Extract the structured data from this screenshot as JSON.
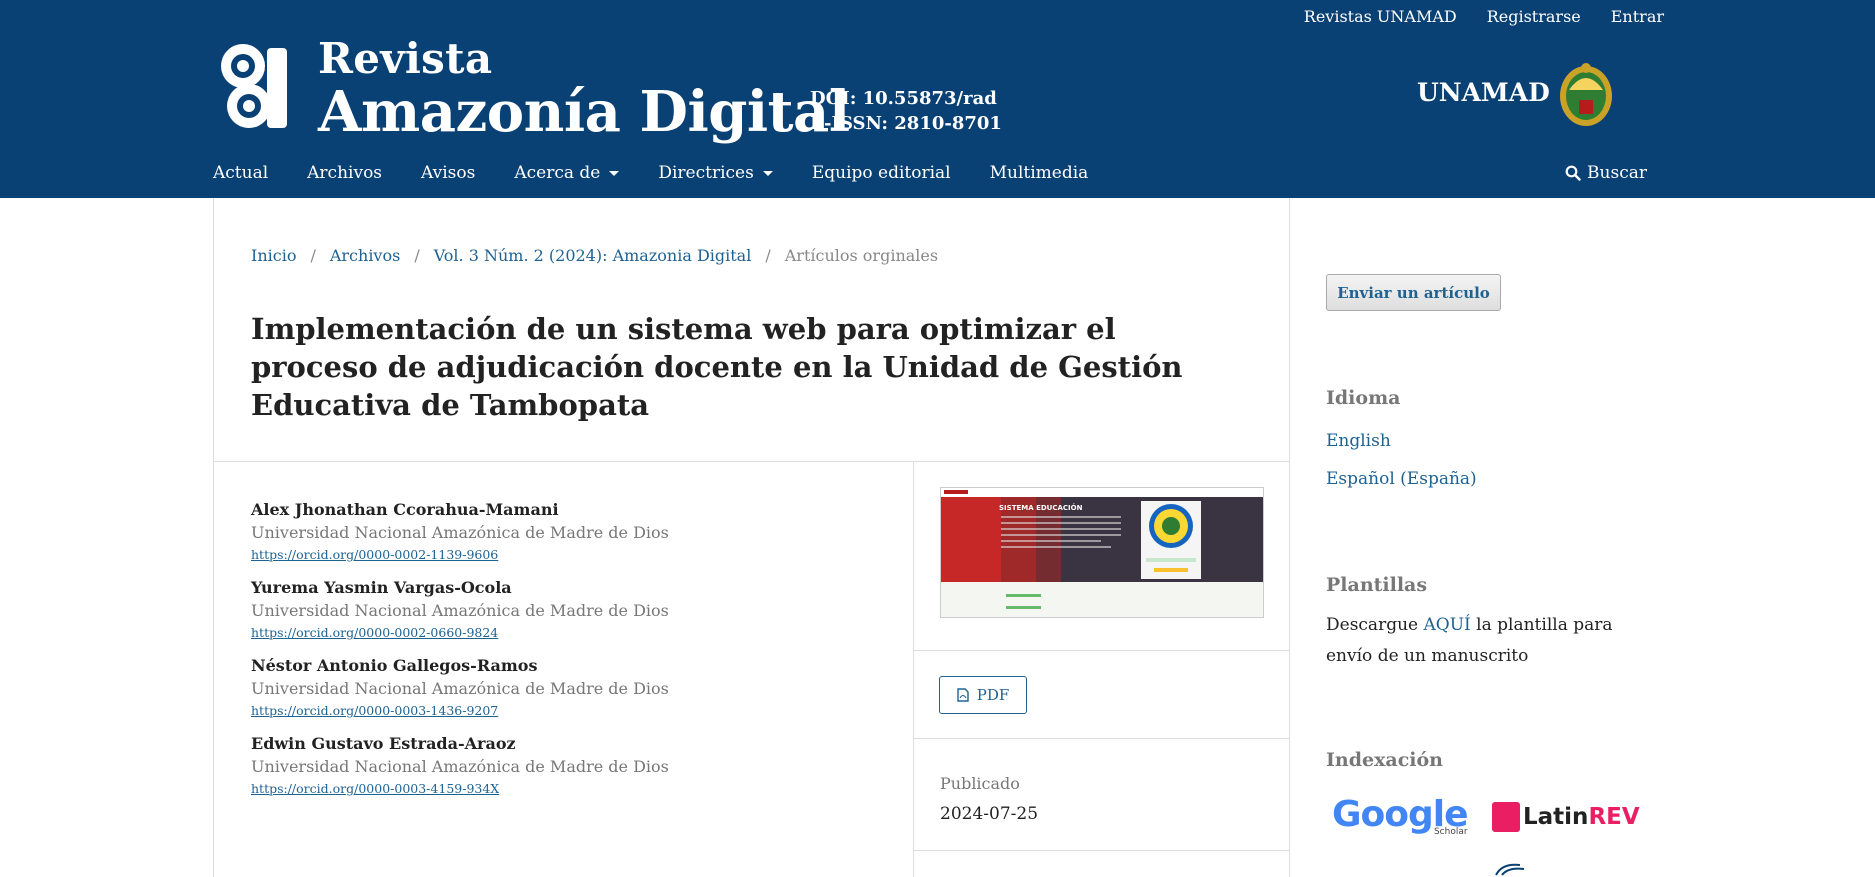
{
  "user_nav": [
    "Revistas UNAMAD",
    "Registrarse",
    "Entrar"
  ],
  "site": {
    "title_line1": "Revista",
    "title_line2": "Amazonía Digital",
    "doi": "DOI: 10.55873/rad",
    "issn": "E-ISSN: 2810-8701",
    "institution": "UNAMAD"
  },
  "main_nav": {
    "items": [
      "Actual",
      "Archivos",
      "Avisos",
      "Acerca de",
      "Directrices",
      "Equipo editorial",
      "Multimedia"
    ],
    "search_label": "Buscar"
  },
  "breadcrumb": {
    "items": [
      "Inicio",
      "Archivos",
      "Vol. 3 Núm. 2 (2024): Amazonia Digital"
    ],
    "current": "Artículos orginales",
    "separator": "/"
  },
  "article": {
    "title": "Implementación de un sistema web para optimizar el proceso de adjudicación docente en la Unidad de Gestión Educativa de Tambopata",
    "authors": [
      {
        "name": "Alex Jhonathan Ccorahua-Mamani",
        "affiliation": "Universidad Nacional Amazónica de Madre de Dios",
        "orcid": "https://orcid.org/0000-0002-1139-9606"
      },
      {
        "name": "Yurema Yasmin Vargas-Ocola",
        "affiliation": "Universidad Nacional Amazónica de Madre de Dios",
        "orcid": "https://orcid.org/0000-0002-0660-9824"
      },
      {
        "name": "Néstor Antonio Gallegos-Ramos",
        "affiliation": "Universidad Nacional Amazónica de Madre de Dios",
        "orcid": "https://orcid.org/0000-0003-1436-9207"
      },
      {
        "name": "Edwin Gustavo Estrada-Araoz",
        "affiliation": "Universidad Nacional Amazónica de Madre de Dios",
        "orcid": "https://orcid.org/0000-0003-4159-934X"
      }
    ],
    "pdf_label": "PDF",
    "published_label": "Publicado",
    "published_date": "2024-07-25",
    "thumbnail_heading": "SISTEMA EDUCACIÓN"
  },
  "sidebar": {
    "submit_label": "Enviar un artículo",
    "language_heading": "Idioma",
    "languages": [
      "English",
      "Español (España)"
    ],
    "templates_heading": "Plantillas",
    "templates_text_before": "Descargue ",
    "templates_link": "AQUÍ",
    "templates_text_after": " la plantilla para envío de un manuscrito",
    "indexing_heading": "Indexación",
    "google_scholar": "Google",
    "google_scholar_sub": "Scholar",
    "latinrev_prefix": "Latin",
    "latinrev_suffix": "REV"
  },
  "colors": {
    "header_bg": "#0a4174",
    "link": "#1e6292",
    "muted": "#777777"
  }
}
